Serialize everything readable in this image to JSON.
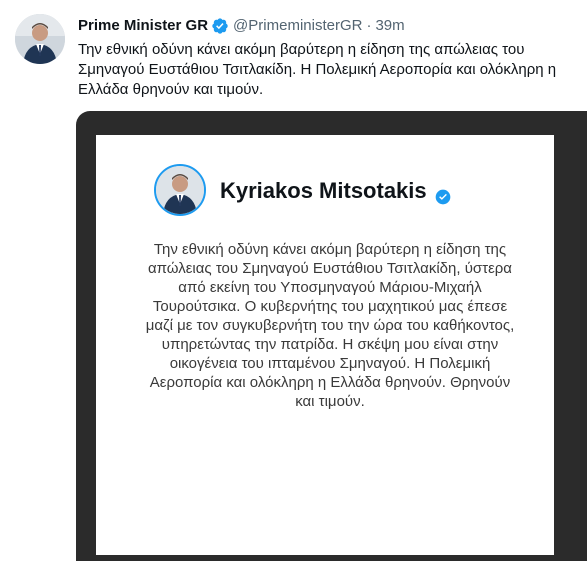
{
  "tweet": {
    "display_name": "Prime Minister GR",
    "handle": "@PrimeministerGR",
    "separator": "·",
    "time": "39m",
    "text": "Την εθνική οδύνη κάνει ακόμη βαρύτερη η είδηση της απώλειας του Σμηναγού Ευστάθιου Τσιτλακίδη. Η Πολεμική Αεροπορία και ολόκληρη η Ελλάδα θρηνούν και τιμούν.",
    "verified_color": "#1d9bf0"
  },
  "media_card": {
    "name": "Kyriakos Mitsotakis",
    "body": "Την εθνική οδύνη κάνει ακόμη βαρύτερη η είδηση της απώλειας του Σμηναγού Ευστάθιου Τσιτλακίδη, ύστερα από εκείνη του Υποσμηναγού Μάριου-Μιχαήλ Τουρούτσικα. Ο κυβερνήτης του μαχητικού μας έπεσε μαζί με τον συγκυβερνήτη του την ώρα του καθήκοντος, υπηρετώντας την πατρίδα. Η σκέψη μου είναι στην οικογένεια του ιπταμένου Σμηναγού. Η Πολεμική Αεροπορία και ολόκληρη η Ελλάδα θρηνούν. Θρηνούν και τιμούν.",
    "frame_color": "#2b2b2b"
  }
}
